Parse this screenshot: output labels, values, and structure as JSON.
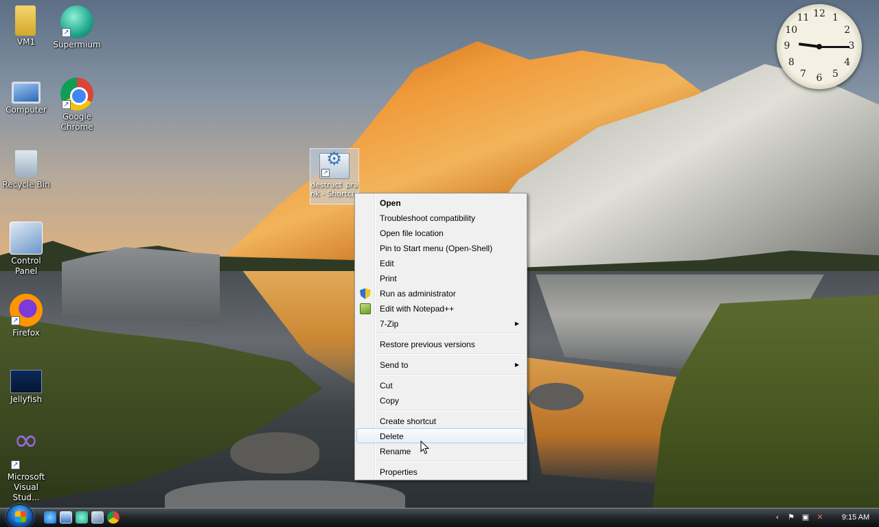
{
  "desktop_icons": [
    {
      "label": "VM1",
      "shortcut": false,
      "icon": "folder-icon"
    },
    {
      "label": "Supermium",
      "shortcut": true,
      "icon": "supermium-icon"
    },
    {
      "label": "Computer",
      "shortcut": false,
      "icon": "computer-icon"
    },
    {
      "label": "Google Chrome",
      "shortcut": true,
      "icon": "chrome-icon"
    },
    {
      "label": "Recycle Bin",
      "shortcut": false,
      "icon": "recycle-bin-icon"
    },
    {
      "label": "Control Panel",
      "shortcut": false,
      "icon": "control-panel-icon"
    },
    {
      "label": "Firefox",
      "shortcut": true,
      "icon": "firefox-icon"
    },
    {
      "label": "Jellyfish",
      "shortcut": false,
      "icon": "image-file-icon"
    },
    {
      "label": "Microsoft Visual Stud...",
      "shortcut": true,
      "icon": "visual-studio-icon"
    }
  ],
  "selected_file": {
    "line1": "destruct_pra",
    "line2": "nk - Shortcut",
    "icon": "shortcut-file-icon"
  },
  "clock": {
    "hour": 9,
    "minute": 15,
    "numerals": [
      "12",
      "1",
      "2",
      "3",
      "4",
      "5",
      "6",
      "7",
      "8",
      "9",
      "10",
      "11"
    ]
  },
  "context_menu": {
    "items": [
      {
        "label": "Open",
        "bold": true
      },
      {
        "label": "Troubleshoot compatibility"
      },
      {
        "label": "Open file location"
      },
      {
        "label": "Pin to Start menu (Open-Shell)"
      },
      {
        "label": "Edit"
      },
      {
        "label": "Print"
      },
      {
        "label": "Run as administrator",
        "icon": "shield-icon"
      },
      {
        "label": "Edit with Notepad++",
        "icon": "notepad-plus-plus-icon"
      },
      {
        "label": "7-Zip",
        "submenu": true
      },
      {
        "separator": true
      },
      {
        "label": "Restore previous versions"
      },
      {
        "separator": true
      },
      {
        "label": "Send to",
        "submenu": true
      },
      {
        "separator": true
      },
      {
        "label": "Cut"
      },
      {
        "label": "Copy"
      },
      {
        "separator": true
      },
      {
        "label": "Create shortcut"
      },
      {
        "label": "Delete",
        "hover": true
      },
      {
        "label": "Rename"
      },
      {
        "separator": true
      },
      {
        "label": "Properties"
      }
    ]
  },
  "taskbar": {
    "quick_launch": [
      "internet-explorer-icon",
      "show-desktop-icon",
      "supermium-icon",
      "switch-windows-icon",
      "chrome-icon"
    ],
    "tray_icons": [
      "show-hidden-icons-chevron",
      "action-center-flag-icon",
      "network-icon",
      "volume-muted-icon"
    ],
    "time": "9:15 AM"
  }
}
